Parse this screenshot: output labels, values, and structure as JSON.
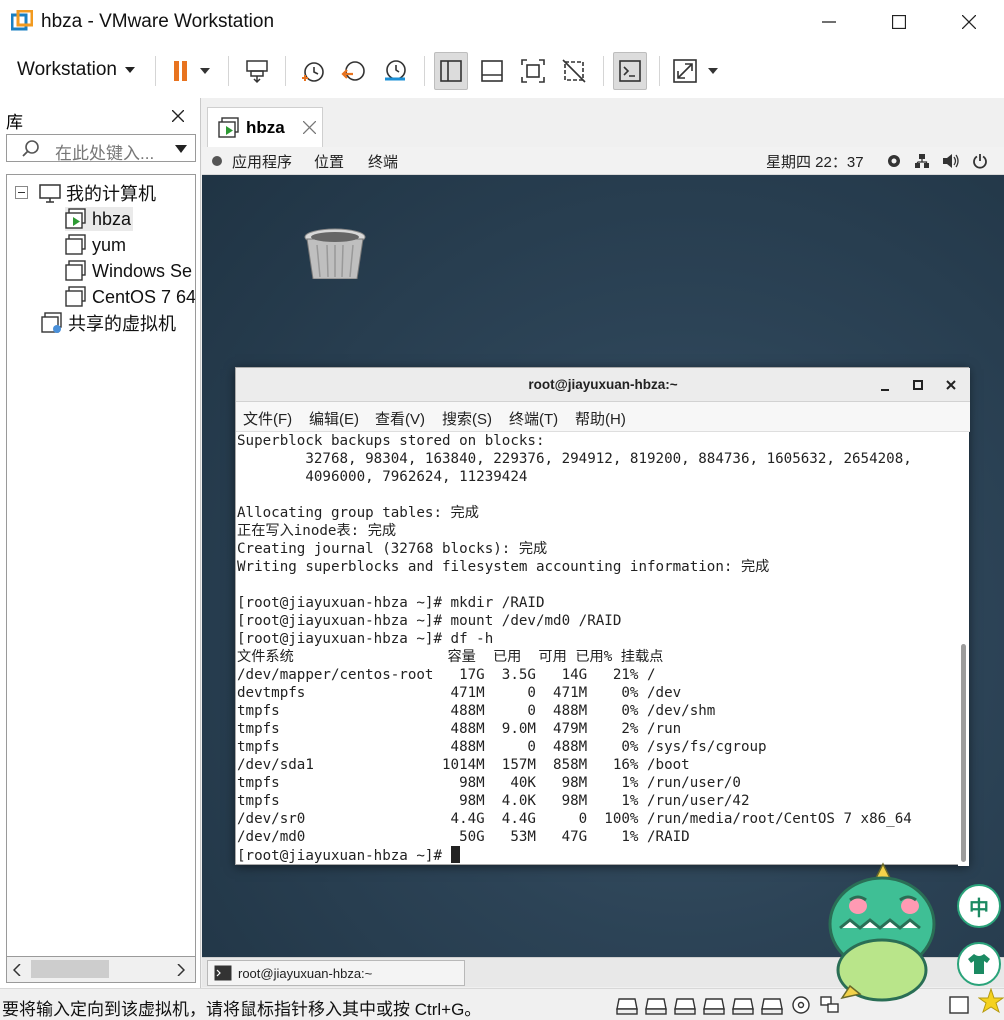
{
  "window": {
    "title": "hbza - VMware Workstation"
  },
  "toolbar": {
    "workstation_label": "Workstation"
  },
  "library": {
    "label": "库",
    "search_placeholder": "在此处键入...",
    "tree": {
      "my_computer": "我的计算机",
      "vms": [
        "hbza",
        "yum",
        "Windows Se",
        "CentOS 7 64"
      ],
      "shared": "共享的虚拟机"
    }
  },
  "vm_tab": {
    "label": "hbza"
  },
  "gnome": {
    "apps": "应用程序",
    "places": "位置",
    "terminal": "终端",
    "clock": "星期四 22：37"
  },
  "terminal": {
    "title": "root@jiayuxuan-hbza:~",
    "menu": [
      "文件(F)",
      "编辑(E)",
      "查看(V)",
      "搜索(S)",
      "终端(T)",
      "帮助(H)"
    ],
    "lines": [
      "Superblock backups stored on blocks:",
      "        32768, 98304, 163840, 229376, 294912, 819200, 884736, 1605632, 2654208,",
      "        4096000, 7962624, 11239424",
      "",
      "Allocating group tables: 完成",
      "正在写入inode表: 完成",
      "Creating journal (32768 blocks): 完成",
      "Writing superblocks and filesystem accounting information: 完成",
      "",
      "[root@jiayuxuan-hbza ~]# mkdir /RAID",
      "[root@jiayuxuan-hbza ~]# mount /dev/md0 /RAID",
      "[root@jiayuxuan-hbza ~]# df -h",
      "文件系统                  容量  已用  可用 已用% 挂载点",
      "/dev/mapper/centos-root   17G  3.5G   14G   21% /",
      "devtmpfs                 471M     0  471M    0% /dev",
      "tmpfs                    488M     0  488M    0% /dev/shm",
      "tmpfs                    488M  9.0M  479M    2% /run",
      "tmpfs                    488M     0  488M    0% /sys/fs/cgroup",
      "/dev/sda1               1014M  157M  858M   16% /boot",
      "tmpfs                     98M   40K   98M    1% /run/user/0",
      "tmpfs                     98M  4.0K   98M    1% /run/user/42",
      "/dev/sr0                 4.4G  4.4G     0  100% /run/media/root/CentOS 7 x86_64",
      "/dev/md0                  50G   53M   47G    1% /RAID"
    ],
    "prompt": "[root@jiayuxuan-hbza ~]# "
  },
  "taskbar": {
    "task_label": "root@jiayuxuan-hbza:~"
  },
  "status": {
    "text": "要将输入定向到该虚拟机，请将鼠标指针移入其中或按 Ctrl+G。"
  },
  "overlay": {
    "ime_label": "中"
  }
}
